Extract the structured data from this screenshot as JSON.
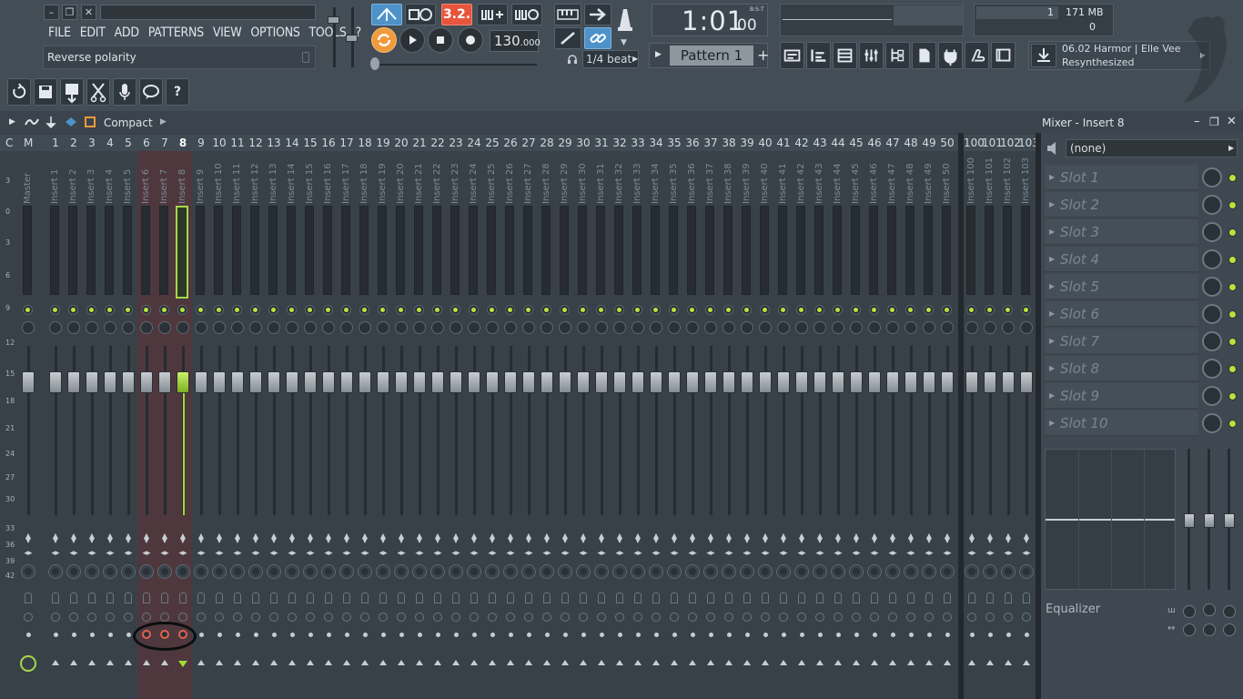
{
  "menu": [
    "FILE",
    "EDIT",
    "ADD",
    "PATTERNS",
    "VIEW",
    "OPTIONS",
    "TOOLS",
    "?"
  ],
  "hint": "Reverse polarity",
  "transport": {
    "time_main": "1:01",
    "time_sub": "00",
    "time_format": "B:S:T",
    "tempo_int": "130",
    "tempo_dec": ".000",
    "step_label": "1/4 beat",
    "pattern_name": "Pattern 1",
    "countdown": "3.2."
  },
  "monitor": {
    "cpu": "1",
    "memory": "171 MB",
    "polyphony": "0"
  },
  "news": {
    "line1": "06.02  Harmor | Elle Vee",
    "line2": "Resynthesized"
  },
  "mixer_header": {
    "view_mode": "Compact",
    "title": "Mixer - Insert 8"
  },
  "mixer": {
    "column_headers": [
      "C",
      "M"
    ],
    "selected_insert": 8,
    "master_label": "Master",
    "insert_numbers": [
      "1",
      "2",
      "3",
      "4",
      "5",
      "6",
      "7",
      "8",
      "9",
      "10",
      "11",
      "12",
      "13",
      "14",
      "15",
      "16",
      "17",
      "18",
      "19",
      "20",
      "21",
      "22",
      "23",
      "24",
      "25",
      "26",
      "27",
      "28",
      "29",
      "30",
      "31",
      "32",
      "33",
      "34",
      "35",
      "36",
      "37",
      "38",
      "39",
      "40",
      "41",
      "42",
      "43",
      "44",
      "45",
      "46",
      "47",
      "48",
      "49",
      "50"
    ],
    "insert_names": [
      "Insert 1",
      "Insert 2",
      "Insert 3",
      "Insert 4",
      "Insert 5",
      "Insert 6",
      "Insert 7",
      "Insert 8",
      "Insert 9",
      "Insert 10",
      "Insert 11",
      "Insert 12",
      "Insert 13",
      "Insert 14",
      "Insert 15",
      "Insert 16",
      "Insert 17",
      "Insert 18",
      "Insert 19",
      "Insert 20",
      "Insert 21",
      "Insert 22",
      "Insert 23",
      "Insert 24",
      "Insert 25",
      "Insert 26",
      "Insert 27",
      "Insert 28",
      "Insert 29",
      "Insert 30",
      "Insert 31",
      "Insert 32",
      "Insert 33",
      "Insert 34",
      "Insert 35",
      "Insert 36",
      "Insert 37",
      "Insert 38",
      "Insert 39",
      "Insert 40",
      "Insert 41",
      "Insert 42",
      "Insert 43",
      "Insert 44",
      "Insert 45",
      "Insert 46",
      "Insert 47",
      "Insert 48",
      "Insert 49",
      "Insert 50"
    ],
    "extra_numbers": [
      "100",
      "101",
      "102",
      "103"
    ],
    "extra_names": [
      "Insert 100",
      "Insert 101",
      "Insert 102",
      "Insert 103"
    ],
    "reversed_polarity_inserts": [
      6,
      7,
      8
    ],
    "db_scale": [
      "3",
      "0",
      "3",
      "6",
      "9",
      "12",
      "15",
      "18",
      "21",
      "24",
      "27",
      "30",
      "33",
      "36",
      "39",
      "42"
    ]
  },
  "effects": {
    "preset": "(none)",
    "slots": [
      "Slot 1",
      "Slot 2",
      "Slot 3",
      "Slot 4",
      "Slot 5",
      "Slot 6",
      "Slot 7",
      "Slot 8",
      "Slot 9",
      "Slot 10"
    ],
    "eq_label": "Equalizer"
  },
  "colors": {
    "accent_green": "#a8d64a",
    "polarity_red": "#e0624f",
    "tempo_highlight": "#f09a3c",
    "countdown_red": "#e7553c"
  }
}
